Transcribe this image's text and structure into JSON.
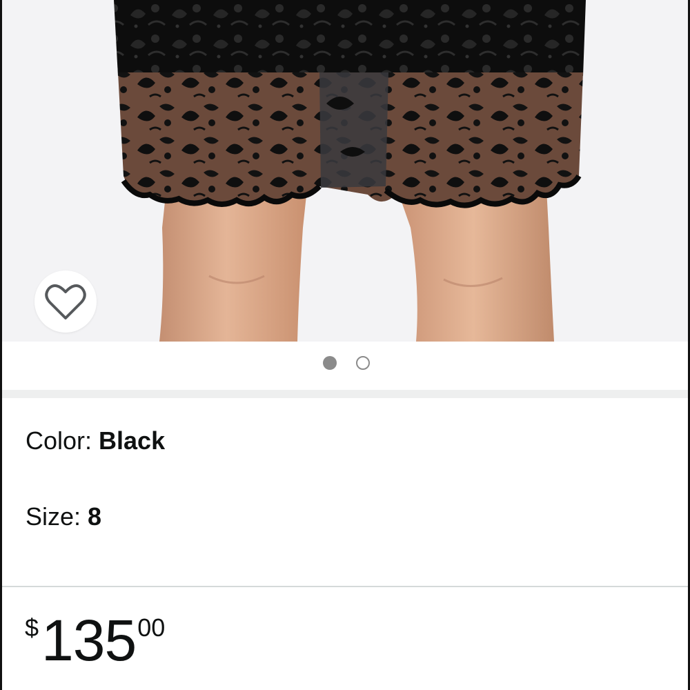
{
  "product": {
    "image_alt": "Black lace pencil skirt with scalloped hem",
    "wishlist_icon": "heart-outline-icon",
    "carousel": {
      "count": 2,
      "active_index": 0
    }
  },
  "variations": {
    "color_label": "Color: ",
    "color_value": "Black",
    "size_label": "Size: ",
    "size_value": "8"
  },
  "price": {
    "symbol": "$",
    "whole": "135",
    "fraction": "00"
  },
  "colors": {
    "image_bg": "#f3f3f5",
    "dot_active": "#8b8b8b",
    "text": "#0f1111",
    "divider": "#d5d9d9"
  }
}
